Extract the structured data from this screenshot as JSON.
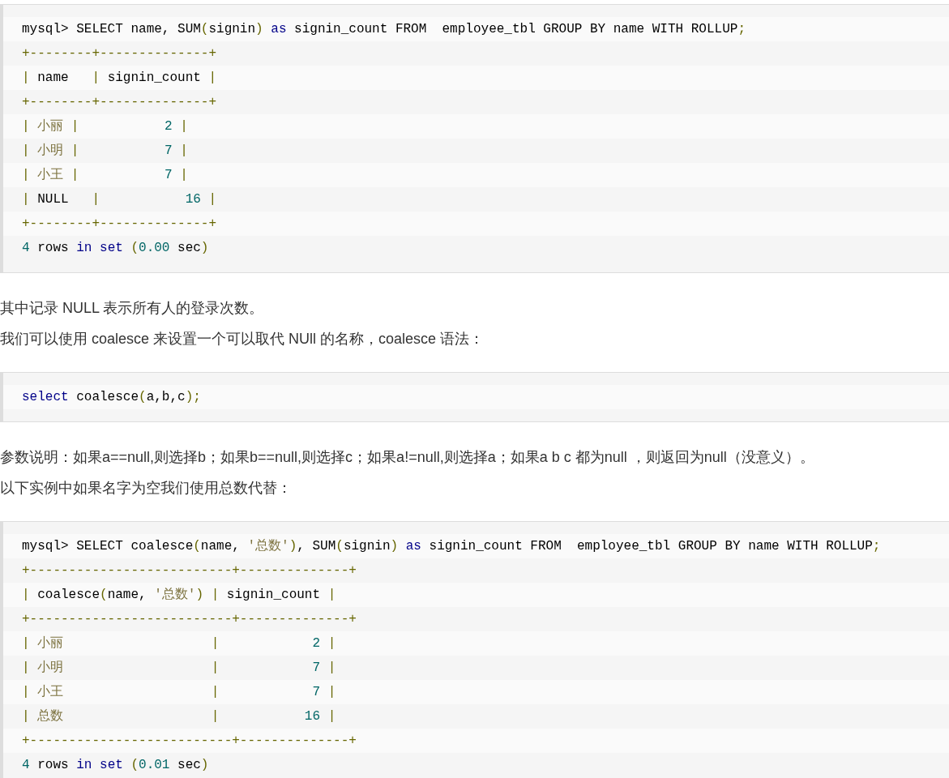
{
  "content": [
    {
      "kind": "code",
      "lines": [
        [
          {
            "kind": "plain",
            "text": "mysql> SELECT name, SUM"
          },
          {
            "kind": "punct",
            "text": "("
          },
          {
            "kind": "plain",
            "text": "signin"
          },
          {
            "kind": "punct",
            "text": ")"
          },
          {
            "kind": "keyword",
            "text": " as"
          },
          {
            "kind": "plain",
            "text": " signin_count FROM  employee_tbl GROUP BY name WITH ROLLUP"
          },
          {
            "kind": "punct",
            "text": ";"
          }
        ],
        [
          {
            "kind": "punct",
            "text": "+--------+--------------+"
          }
        ],
        [
          {
            "kind": "punct",
            "text": "| "
          },
          {
            "kind": "plain",
            "text": "name   "
          },
          {
            "kind": "punct",
            "text": "| "
          },
          {
            "kind": "plain",
            "text": "signin_count "
          },
          {
            "kind": "punct",
            "text": "|"
          }
        ],
        [
          {
            "kind": "punct",
            "text": "+--------+--------------+"
          }
        ],
        [
          {
            "kind": "punct",
            "text": "| "
          },
          {
            "kind": "string",
            "text": "小丽"
          },
          {
            "kind": "punct",
            "text": " |           "
          },
          {
            "kind": "number",
            "text": "2"
          },
          {
            "kind": "punct",
            "text": " |"
          }
        ],
        [
          {
            "kind": "punct",
            "text": "| "
          },
          {
            "kind": "string",
            "text": "小明"
          },
          {
            "kind": "punct",
            "text": " |           "
          },
          {
            "kind": "number",
            "text": "7"
          },
          {
            "kind": "punct",
            "text": " |"
          }
        ],
        [
          {
            "kind": "punct",
            "text": "| "
          },
          {
            "kind": "string",
            "text": "小王"
          },
          {
            "kind": "punct",
            "text": " |           "
          },
          {
            "kind": "number",
            "text": "7"
          },
          {
            "kind": "punct",
            "text": " |"
          }
        ],
        [
          {
            "kind": "punct",
            "text": "| "
          },
          {
            "kind": "plain",
            "text": "NULL   "
          },
          {
            "kind": "punct",
            "text": "|           "
          },
          {
            "kind": "number",
            "text": "16"
          },
          {
            "kind": "punct",
            "text": " |"
          }
        ],
        [
          {
            "kind": "punct",
            "text": "+--------+--------------+"
          }
        ],
        [
          {
            "kind": "number",
            "text": "4"
          },
          {
            "kind": "plain",
            "text": " rows "
          },
          {
            "kind": "keyword",
            "text": "in set"
          },
          {
            "kind": "punct",
            "text": " ("
          },
          {
            "kind": "number",
            "text": "0.00"
          },
          {
            "kind": "plain",
            "text": " sec"
          },
          {
            "kind": "punct",
            "text": ")"
          }
        ]
      ]
    },
    {
      "kind": "paragraph",
      "text": "其中记录 NULL 表示所有人的登录次数。"
    },
    {
      "kind": "paragraph",
      "text": "我们可以使用 coalesce 来设置一个可以取代 NUll 的名称，coalesce 语法："
    },
    {
      "kind": "code",
      "lines": [
        [
          {
            "kind": "keyword",
            "text": "select"
          },
          {
            "kind": "plain",
            "text": " coalesce"
          },
          {
            "kind": "punct",
            "text": "("
          },
          {
            "kind": "plain",
            "text": "a,b,c"
          },
          {
            "kind": "punct",
            "text": ");"
          }
        ]
      ]
    },
    {
      "kind": "paragraph",
      "text": "参数说明：如果a==null,则选择b；如果b==null,则选择c；如果a!=null,则选择a；如果a b c 都为null ，则返回为null（没意义）。"
    },
    {
      "kind": "paragraph",
      "text": "以下实例中如果名字为空我们使用总数代替："
    },
    {
      "kind": "code",
      "lines": [
        [
          {
            "kind": "plain",
            "text": "mysql> SELECT coalesce"
          },
          {
            "kind": "punct",
            "text": "("
          },
          {
            "kind": "plain",
            "text": "name, "
          },
          {
            "kind": "string",
            "text": "'总数'"
          },
          {
            "kind": "punct",
            "text": ")"
          },
          {
            "kind": "plain",
            "text": ", SUM"
          },
          {
            "kind": "punct",
            "text": "("
          },
          {
            "kind": "plain",
            "text": "signin"
          },
          {
            "kind": "punct",
            "text": ")"
          },
          {
            "kind": "keyword",
            "text": " as"
          },
          {
            "kind": "plain",
            "text": " signin_count FROM  employee_tbl GROUP BY name WITH ROLLUP"
          },
          {
            "kind": "punct",
            "text": ";"
          }
        ],
        [
          {
            "kind": "punct",
            "text": "+--------------------------+--------------+"
          }
        ],
        [
          {
            "kind": "punct",
            "text": "| "
          },
          {
            "kind": "plain",
            "text": "coalesce"
          },
          {
            "kind": "punct",
            "text": "("
          },
          {
            "kind": "plain",
            "text": "name, "
          },
          {
            "kind": "string",
            "text": "'总数'"
          },
          {
            "kind": "punct",
            "text": ") | "
          },
          {
            "kind": "plain",
            "text": "signin_count "
          },
          {
            "kind": "punct",
            "text": "|"
          }
        ],
        [
          {
            "kind": "punct",
            "text": "+--------------------------+--------------+"
          }
        ],
        [
          {
            "kind": "punct",
            "text": "| "
          },
          {
            "kind": "string",
            "text": "小丽"
          },
          {
            "kind": "punct",
            "text": "                   |            "
          },
          {
            "kind": "number",
            "text": "2"
          },
          {
            "kind": "punct",
            "text": " |"
          }
        ],
        [
          {
            "kind": "punct",
            "text": "| "
          },
          {
            "kind": "string",
            "text": "小明"
          },
          {
            "kind": "punct",
            "text": "                   |            "
          },
          {
            "kind": "number",
            "text": "7"
          },
          {
            "kind": "punct",
            "text": " |"
          }
        ],
        [
          {
            "kind": "punct",
            "text": "| "
          },
          {
            "kind": "string",
            "text": "小王"
          },
          {
            "kind": "punct",
            "text": "                   |            "
          },
          {
            "kind": "number",
            "text": "7"
          },
          {
            "kind": "punct",
            "text": " |"
          }
        ],
        [
          {
            "kind": "punct",
            "text": "| "
          },
          {
            "kind": "string",
            "text": "总数"
          },
          {
            "kind": "punct",
            "text": "                   |           "
          },
          {
            "kind": "number",
            "text": "16"
          },
          {
            "kind": "punct",
            "text": " |"
          }
        ],
        [
          {
            "kind": "punct",
            "text": "+--------------------------+--------------+"
          }
        ],
        [
          {
            "kind": "number",
            "text": "4"
          },
          {
            "kind": "plain",
            "text": " rows "
          },
          {
            "kind": "keyword",
            "text": "in set"
          },
          {
            "kind": "punct",
            "text": " ("
          },
          {
            "kind": "number",
            "text": "0.01"
          },
          {
            "kind": "plain",
            "text": " sec"
          },
          {
            "kind": "punct",
            "text": ")"
          }
        ]
      ]
    }
  ]
}
